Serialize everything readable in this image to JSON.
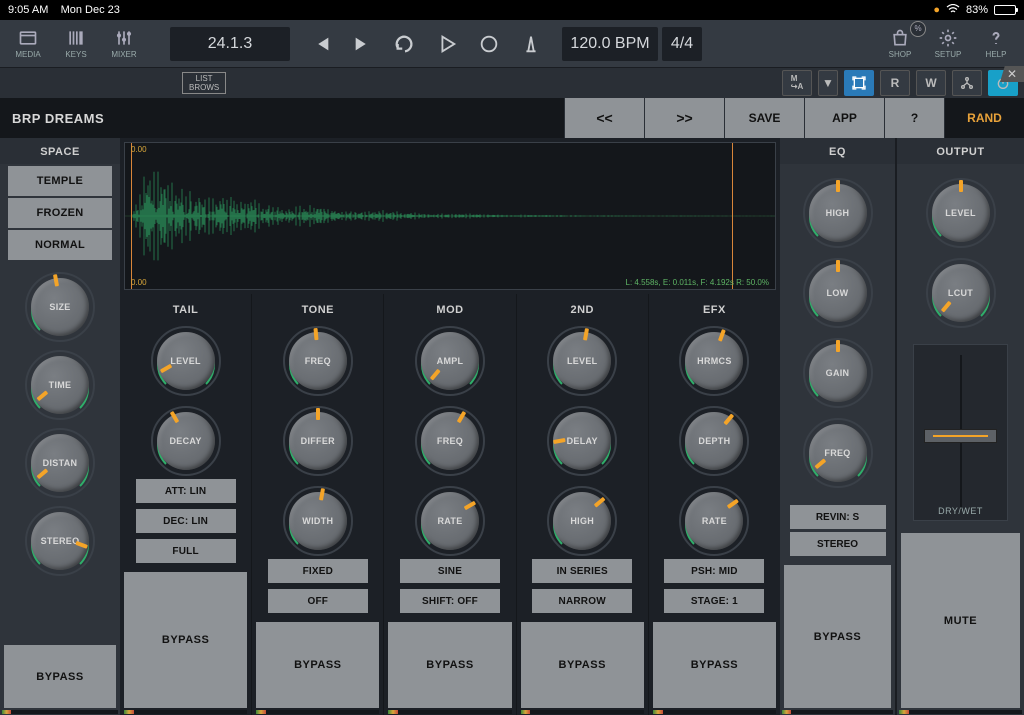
{
  "status": {
    "time": "9:05 AM",
    "date": "Mon Dec 23",
    "battery": "83%"
  },
  "toolbar": {
    "media": "MEDIA",
    "keys": "KEYS",
    "mixer": "MIXER",
    "position": "24.1.3",
    "tempo": "120.0 BPM",
    "sig": "4/4",
    "shop": "SHOP",
    "setup": "SETUP",
    "help": "HELP"
  },
  "subbar": {
    "list": "LIST",
    "brows": "BROWS",
    "r": "R",
    "w": "W"
  },
  "preset": {
    "name": "BRP DREAMS",
    "prev": "<<",
    "next": ">>",
    "save": "SAVE",
    "app": "APP",
    "q": "?",
    "rand": "RAND"
  },
  "wave": {
    "zero": "0.00",
    "info": "L: 4.558s, E: 0.011s, F: 4.192s R: 50.0%"
  },
  "space": {
    "title": "SPACE",
    "buttons": [
      "TEMPLE",
      "FROZEN",
      "NORMAL"
    ],
    "knobs": [
      "SIZE",
      "TIME",
      "DISTAN",
      "STEREO"
    ],
    "bypass": "BYPASS"
  },
  "cols": [
    {
      "title": "TAIL",
      "knobs": [
        "LEVEL",
        "DECAY"
      ],
      "params": [
        "ATT: LIN",
        "DEC: LIN",
        "FULL"
      ],
      "bypass": "BYPASS"
    },
    {
      "title": "TONE",
      "knobs": [
        "FREQ",
        "DIFFER",
        "WIDTH"
      ],
      "params": [
        "FIXED",
        "OFF"
      ],
      "bypass": "BYPASS"
    },
    {
      "title": "MOD",
      "knobs": [
        "AMPL",
        "FREQ",
        "RATE"
      ],
      "params": [
        "SINE",
        "SHIFT: OFF"
      ],
      "bypass": "BYPASS"
    },
    {
      "title": "2ND",
      "knobs": [
        "LEVEL",
        "DELAY",
        "HIGH"
      ],
      "params": [
        "IN SERIES",
        "NARROW"
      ],
      "bypass": "BYPASS"
    },
    {
      "title": "EFX",
      "knobs": [
        "HRMCS",
        "DEPTH",
        "RATE"
      ],
      "params": [
        "PSH: MID",
        "STAGE: 1"
      ],
      "bypass": "BYPASS"
    }
  ],
  "eq": {
    "title": "EQ",
    "knobs": [
      "HIGH",
      "LOW",
      "GAIN",
      "FREQ"
    ],
    "params": [
      "REVIN: S",
      "STEREO"
    ],
    "bypass": "BYPASS"
  },
  "output": {
    "title": "OUTPUT",
    "knobs": [
      "LEVEL",
      "LCUT"
    ],
    "drywet": "DRY/WET",
    "mute": "MUTE"
  }
}
